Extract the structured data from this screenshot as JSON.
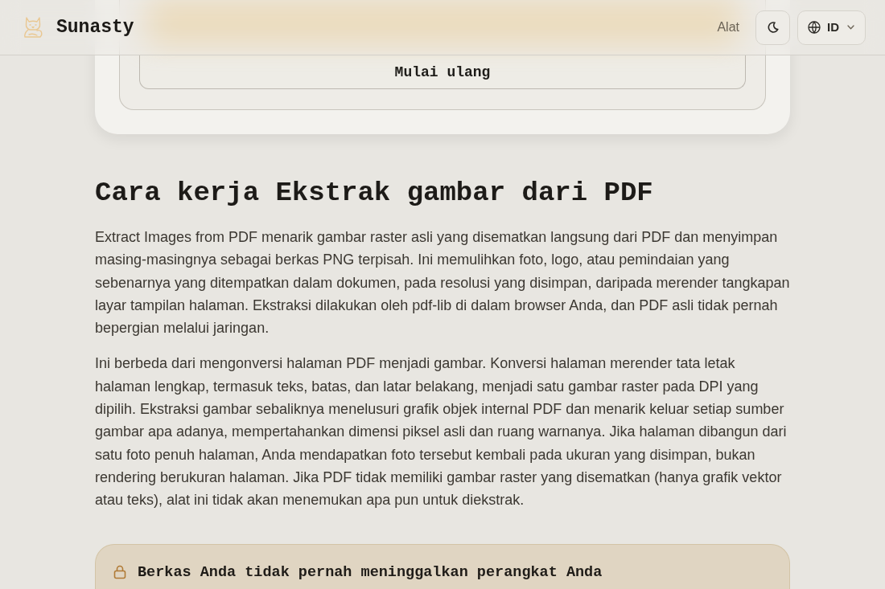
{
  "header": {
    "brand": "Sunasty",
    "nav_link": "Alat",
    "language": "ID"
  },
  "tool_card": {
    "reset_button": "Mulai ulang"
  },
  "section": {
    "heading": "Cara kerja Ekstrak gambar dari PDF",
    "paragraphs": [
      "Extract Images from PDF menarik gambar raster asli yang disematkan langsung dari PDF dan menyimpan masing-masingnya sebagai berkas PNG terpisah. Ini memulihkan foto, logo, atau pemindaian yang sebenarnya yang ditempatkan dalam dokumen, pada resolusi yang disimpan, daripada merender tangkapan layar tampilan halaman. Ekstraksi dilakukan oleh pdf-lib di dalam browser Anda, dan PDF asli tidak pernah bepergian melalui jaringan.",
      "Ini berbeda dari mengonversi halaman PDF menjadi gambar. Konversi halaman merender tata letak halaman lengkap, termasuk teks, batas, dan latar belakang, menjadi satu gambar raster pada DPI yang dipilih. Ekstraksi gambar sebaliknya menelusuri grafik objek internal PDF dan menarik keluar setiap sumber gambar apa adanya, mempertahankan dimensi piksel asli dan ruang warnanya. Jika halaman dibangun dari satu foto penuh halaman, Anda mendapatkan foto tersebut kembali pada ukuran yang disimpan, bukan rendering berukuran halaman. Jika PDF tidak memiliki gambar raster yang disematkan (hanya grafik vektor atau teks), alat ini tidak akan menemukan apa pun untuk diekstrak."
    ]
  },
  "notice": {
    "title": "Berkas Anda tidak pernah meninggalkan perangkat Anda"
  }
}
